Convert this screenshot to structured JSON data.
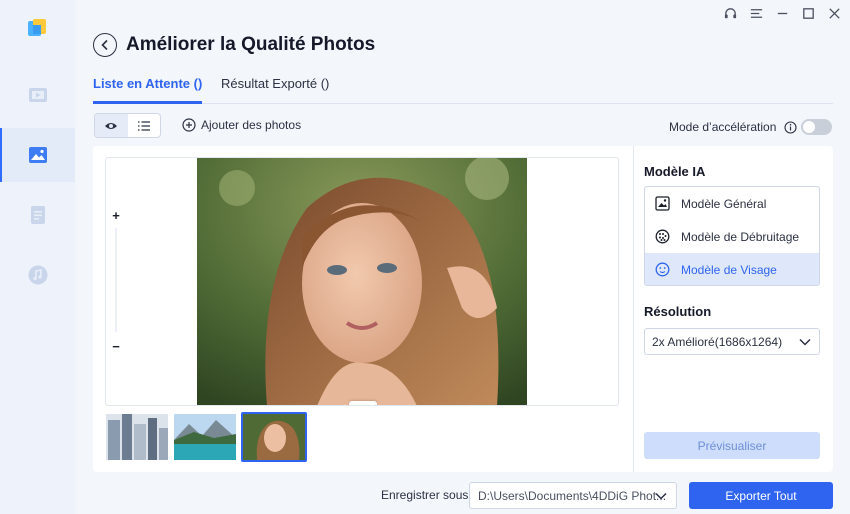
{
  "window": {
    "controls": [
      "headset-icon",
      "menu-icon",
      "minimize-icon",
      "maximize-icon",
      "close-icon"
    ]
  },
  "sidebar": {
    "items": [
      {
        "icon": "video-icon",
        "active": false
      },
      {
        "icon": "photo-icon",
        "active": true
      },
      {
        "icon": "document-icon",
        "active": false
      },
      {
        "icon": "music-icon",
        "active": false
      }
    ]
  },
  "header": {
    "title": "Améliorer la Qualité Photos"
  },
  "tabs": [
    {
      "label": "Liste en Attente ()",
      "active": true
    },
    {
      "label": "Résultat Exporté ()",
      "active": false
    }
  ],
  "toolbar": {
    "add_label": "Ajouter des photos",
    "accel_label": "Mode d’accélération",
    "accel_enabled": false
  },
  "canvas": {
    "zoom_in": "+",
    "zoom_out": "−"
  },
  "thumbnails": [
    {
      "subject": "city-buildings",
      "selected": false
    },
    {
      "subject": "mountain-lake",
      "selected": false
    },
    {
      "subject": "girl-portrait",
      "selected": true
    }
  ],
  "side": {
    "model_heading": "Modèle IA",
    "models": [
      {
        "label": "Modèle Général",
        "icon": "image-icon",
        "selected": false
      },
      {
        "label": "Modèle de Débruitage",
        "icon": "noise-icon",
        "selected": false
      },
      {
        "label": "Modèle de Visage",
        "icon": "face-icon",
        "selected": true
      }
    ],
    "resolution_heading": "Résolution",
    "resolution_value": "2x Amélioré(1686x1264)",
    "preview_label": "Prévisualiser"
  },
  "footer": {
    "save_label": "Enregistrer sous",
    "save_path": "D:\\Users\\Documents\\4DDiG Phot...",
    "export_label": "Exporter Tout"
  },
  "colors": {
    "accent": "#2e64f0",
    "preview_bg": "#cdddfb",
    "selected_bg": "#dfe8fa"
  }
}
